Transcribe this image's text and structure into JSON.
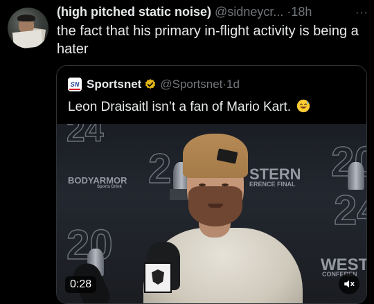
{
  "tweet": {
    "display_name": "(high pitched static noise)",
    "handle": "@sidneycr...",
    "separator": "·",
    "time": "18h",
    "more_label": "···",
    "text": "the fact that his primary in-flight activity is being a hater"
  },
  "quoted_tweet": {
    "logo_text": "SN",
    "display_name": "Sportsnet",
    "handle": "@Sportsnet",
    "separator": "·",
    "time": "1d",
    "text": "Leon Draisaitl isn’t a fan of Mario Kart.",
    "emoji": "sweat-smile-emoji",
    "video": {
      "duration": "0:28",
      "muted": true,
      "backdrop_texts": {
        "sponsor": "BODYARMOR",
        "sponsor_sub": "Sports Drink",
        "western_1": "STERN",
        "western_2": "ERENCE FINAL",
        "west_big": "WEST",
        "west_small": "CONFEREN",
        "hat_patch": "NY"
      }
    }
  },
  "colors": {
    "background": "#000000",
    "text_primary": "#e7e9ea",
    "text_secondary": "#71767b",
    "border": "#2f3336",
    "verified_gold": "#e2b719"
  },
  "icons": [
    "avatar",
    "sportsnet-logo",
    "verified-badge-icon",
    "more-icon",
    "sweat-smile-emoji",
    "mute-icon"
  ]
}
